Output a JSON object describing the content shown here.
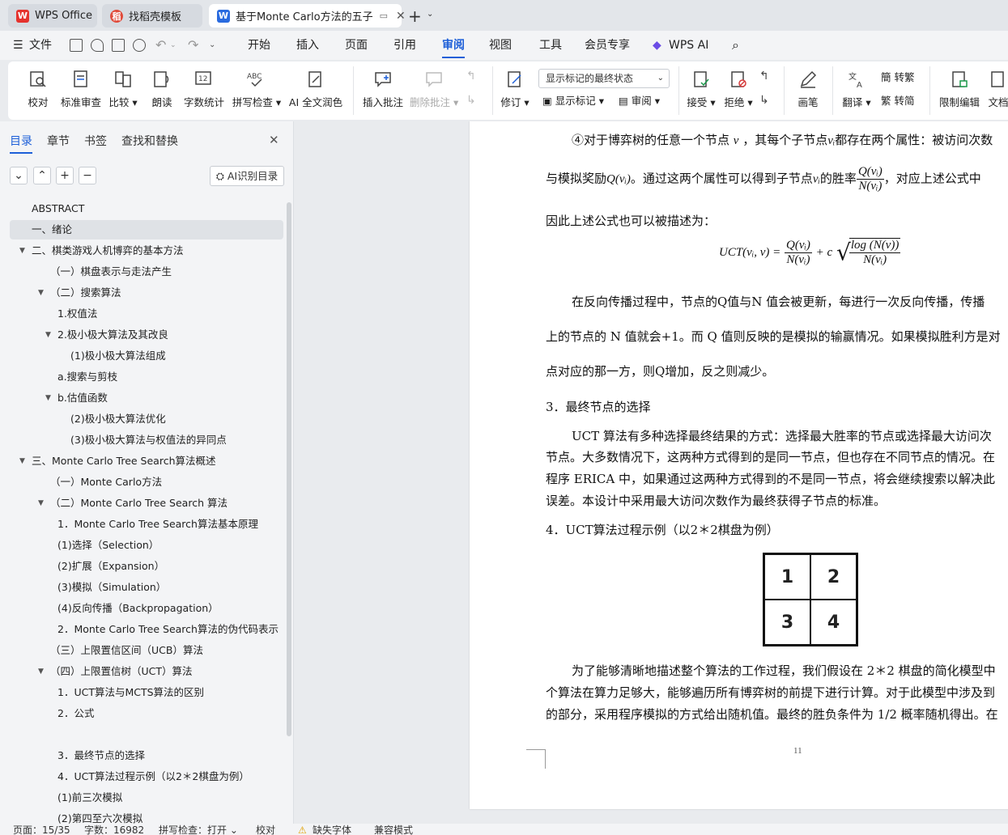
{
  "tabs": [
    {
      "label": "WPS Office",
      "logo": "W",
      "logo_color": "#e5322d"
    },
    {
      "label": "找稻壳模板",
      "logo": "稻",
      "logo_color": "#e04c3c"
    },
    {
      "label": "基于Monte Carlo方法的五子",
      "logo": "W",
      "logo_color": "#2a6bdf"
    }
  ],
  "menu": {
    "file": "文件",
    "items": [
      "开始",
      "插入",
      "页面",
      "引用",
      "审阅",
      "视图",
      "工具",
      "会员专享"
    ],
    "active": "审阅",
    "ai": "WPS AI"
  },
  "ribbon": {
    "proofread": "校对",
    "standard_review": "标准审查",
    "compare": "比较",
    "read_aloud": "朗读",
    "word_count": "字数统计",
    "spell_check": "拼写检查",
    "ai_proof": "AI 全文润色",
    "insert_comment": "插入批注",
    "delete_comment": "删除批注",
    "track": "修订",
    "show_markup_select": "显示标记的最终状态",
    "show_markup": "显示标记",
    "review": "审阅",
    "accept": "接受",
    "reject": "拒绝",
    "pen": "画笔",
    "translate": "翻译",
    "to_traditional": "转繁",
    "to_simplified": "转简",
    "restrict_edit": "限制编辑",
    "doc": "文档"
  },
  "panel": {
    "tabs": [
      "目录",
      "章节",
      "书签",
      "查找和替换"
    ],
    "ai_btn": "AI识别目录"
  },
  "toc": [
    {
      "text": "ABSTRACT",
      "level": 0,
      "arrow": false
    },
    {
      "text": "一、绪论",
      "level": 0,
      "arrow": false,
      "selected": true
    },
    {
      "text": "二、棋类游戏人机博弈的基本方法",
      "level": 0,
      "arrow": true
    },
    {
      "text": "（一）棋盘表示与走法产生",
      "level": 1,
      "arrow": false
    },
    {
      "text": "（二）搜索算法",
      "level": 1,
      "arrow": true
    },
    {
      "text": "1.权值法",
      "level": 2,
      "arrow": false
    },
    {
      "text": "2.极小极大算法及其改良",
      "level": 2,
      "arrow": true
    },
    {
      "text": "(1)极小极大算法组成",
      "level": 3,
      "arrow": false
    },
    {
      "text": "a.搜索与剪枝",
      "level": 2,
      "arrow": false
    },
    {
      "text": "b.估值函数",
      "level": 2,
      "arrow": true
    },
    {
      "text": "(2)极小极大算法优化",
      "level": 3,
      "arrow": false
    },
    {
      "text": "(3)极小极大算法与权值法的异同点",
      "level": 3,
      "arrow": false
    },
    {
      "text": "三、Monte Carlo Tree Search算法概述",
      "level": 0,
      "arrow": true
    },
    {
      "text": "（一）Monte Carlo方法",
      "level": 1,
      "arrow": false
    },
    {
      "text": "（二）Monte Carlo Tree Search 算法",
      "level": 1,
      "arrow": true
    },
    {
      "text": "1．Monte Carlo Tree Search算法基本原理",
      "level": 2,
      "arrow": false
    },
    {
      "text": "(1)选择（Selection）",
      "level": 2,
      "arrow": false
    },
    {
      "text": "(2)扩展（Expansion）",
      "level": 2,
      "arrow": false
    },
    {
      "text": "(3)模拟（Simulation）",
      "level": 2,
      "arrow": false
    },
    {
      "text": "(4)反向传播（Backpropagation）",
      "level": 2,
      "arrow": false
    },
    {
      "text": "2．Monte Carlo Tree Search算法的伪代码表示",
      "level": 2,
      "arrow": false
    },
    {
      "text": "（三）上限置信区间（UCB）算法",
      "level": 1,
      "arrow": false
    },
    {
      "text": "（四）上限置信树（UCT）算法",
      "level": 1,
      "arrow": true
    },
    {
      "text": "1．UCT算法与MCTS算法的区别",
      "level": 2,
      "arrow": false
    },
    {
      "text": "2．公式",
      "level": 2,
      "arrow": false
    },
    {
      "text": "",
      "level": 2,
      "arrow": false
    },
    {
      "text": "3．最终节点的选择",
      "level": 2,
      "arrow": false
    },
    {
      "text": "4．UCT算法过程示例（以2＊2棋盘为例）",
      "level": 2,
      "arrow": false
    },
    {
      "text": "(1)前三次模拟",
      "level": 2,
      "arrow": false
    },
    {
      "text": "(2)第四至六次模拟",
      "level": 2,
      "arrow": false
    }
  ],
  "doc": {
    "p1_a": "④对于博弈树的任意一个节点",
    "p1_v": "v",
    "p1_b": "，其每个子节点",
    "p1_vi": "vᵢ",
    "p1_c": "都存在两个属性：被访问次数",
    "p2_a": "与模拟奖励",
    "p2_q": "Q(vᵢ)",
    "p2_b": "。通过这两个属性可以得到子节点",
    "p2_vi": "vᵢ",
    "p2_c": "的胜率",
    "p2_num": "Q(vᵢ)",
    "p2_den": "N(vᵢ)",
    "p2_d": "，对应上述公式中",
    "p3": "因此上述公式也可以被描述为：",
    "formula_lhs": "UCT(vᵢ, v) =",
    "formula_num1": "Q(vᵢ)",
    "formula_den1": "N(vᵢ)",
    "formula_plus": "+ c",
    "formula_num2": "log (N(v))",
    "formula_den2": "N(vᵢ)",
    "p4": "在反向传播过程中，节点的Q值与N 值会被更新，每进行一次反向传播，传播",
    "p5": "上的节点的 N 值就会+1。而 Q 值则反映的是模拟的输赢情况。如果模拟胜利方是对",
    "p6": "点对应的那一方，则Q增加，反之则减少。",
    "h3": "3．最终节点的选择",
    "p7": "UCT 算法有多种选择最终结果的方式：选择最大胜率的节点或选择最大访问次",
    "p8": "节点。大多数情况下，这两种方式得到的是同一节点，但也存在不同节点的情况。在",
    "p9": "程序 ERICA 中，如果通过这两种方式得到的不是同一节点，将会继续搜索以解决此",
    "p10": "误差。本设计中采用最大访问次数作为最终获得子节点的标准。",
    "h4": "4．UCT算法过程示例（以2＊2棋盘为例）",
    "board": [
      "1",
      "2",
      "3",
      "4"
    ],
    "p11": "为了能够清晰地描述整个算法的工作过程，我们假设在 2＊2 棋盘的简化模型中",
    "p12": "个算法在算力足够大，能够遍历所有博弈树的前提下进行计算。对于此模型中涉及到",
    "p13": "的部分，采用程序模拟的方式给出随机值。最终的胜负条件为 1/2 概率随机得出。在",
    "page_number": "11"
  },
  "status": {
    "page": "页面：15/35",
    "words": "字数：16982",
    "spell": "拼写检查：打开",
    "proof": "校对",
    "font_missing": "缺失字体",
    "compat": "兼容模式"
  }
}
